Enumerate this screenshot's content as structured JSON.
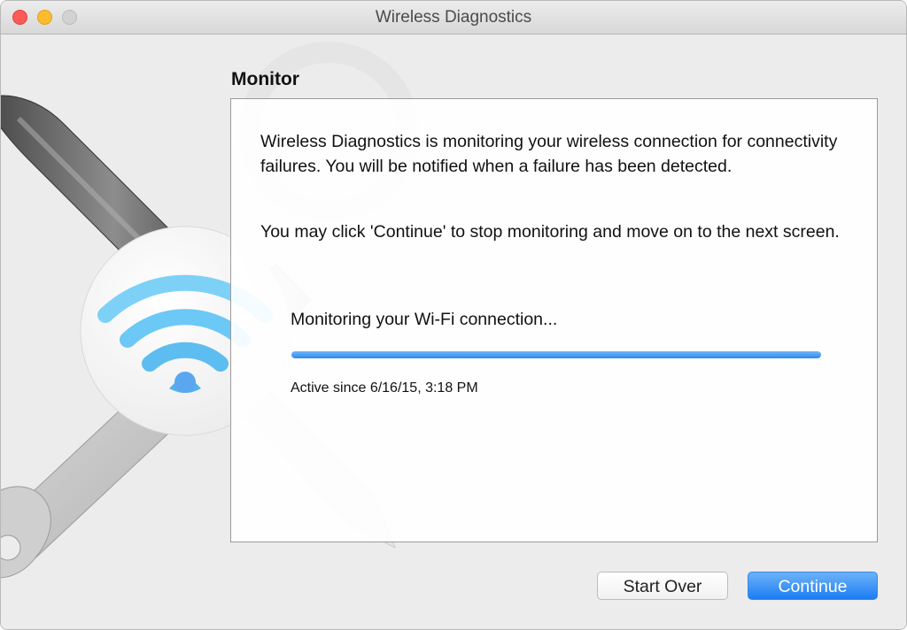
{
  "window": {
    "title": "Wireless Diagnostics",
    "controls": [
      "close",
      "minimize",
      "zoom"
    ]
  },
  "art": {
    "icons": [
      "wrench-icon",
      "screwdriver-icon",
      "wifi-icon"
    ],
    "wifi_color": "#6cc8f5"
  },
  "section": {
    "title": "Monitor"
  },
  "panel": {
    "paragraph1": "Wireless Diagnostics is monitoring your wireless connection for connectivity failures. You will be notified when a failure has been detected.",
    "paragraph2": "You may click 'Continue' to stop monitoring and move on to the next screen.",
    "status": "Monitoring your Wi-Fi connection...",
    "progress_fraction": 1.0,
    "active_since": "Active since 6/16/15, 3:18 PM"
  },
  "buttons": {
    "start_over": "Start Over",
    "continue": "Continue"
  },
  "colors": {
    "accent": "#2f8af0",
    "close": "#fc5b57",
    "minimize": "#fdbb2e",
    "zoom_disabled": "#d2d2d2"
  }
}
